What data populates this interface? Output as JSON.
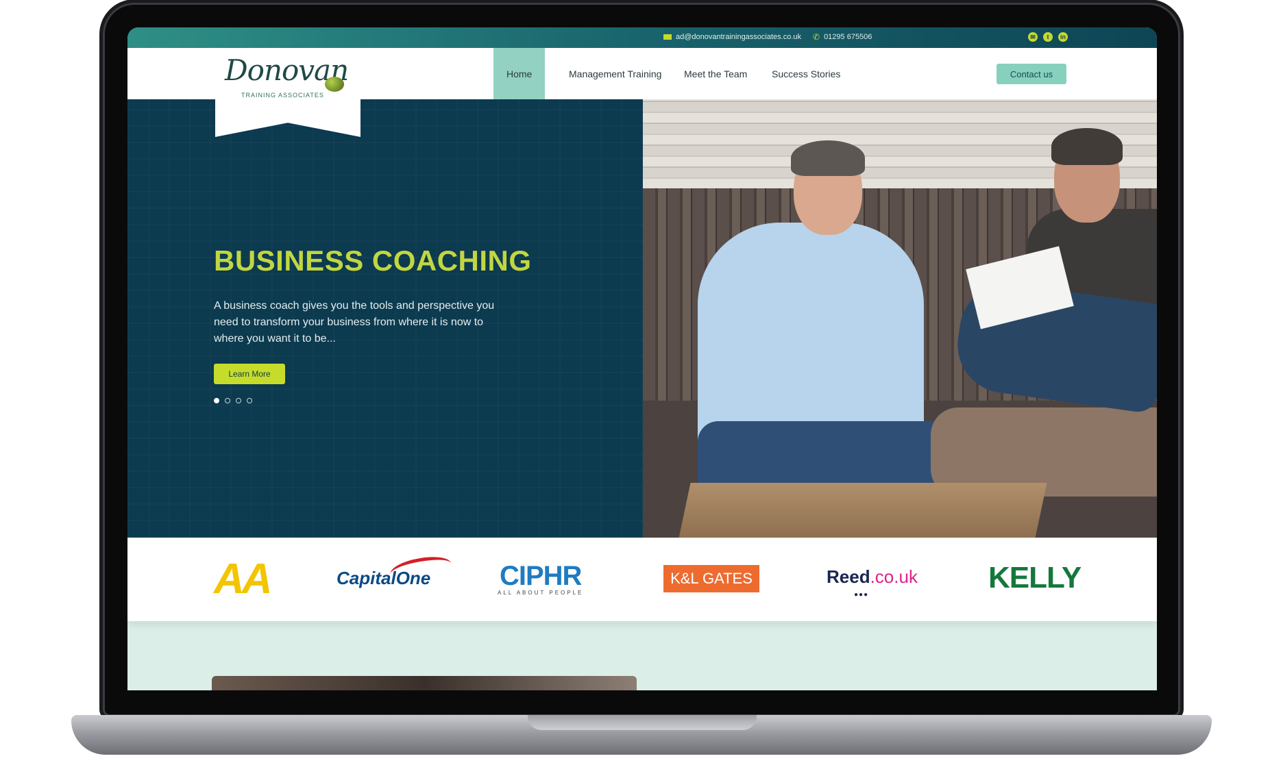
{
  "topbar": {
    "email": "ad@donovantrainingassociates.co.uk",
    "phone": "01295 675506",
    "social": [
      "email-icon",
      "twitter-icon",
      "linkedin-icon"
    ]
  },
  "logo": {
    "name": "Donovan",
    "tagline": "TRAINING ASSOCIATES"
  },
  "nav": {
    "items": [
      "Home",
      "Management Training",
      "Meet the Team",
      "Success Stories"
    ],
    "active": "Home",
    "contact": "Contact us"
  },
  "hero": {
    "title": "BUSINESS COACHING",
    "text": "A business coach gives you the tools and perspective you need to transform your business from where it is now to where you want it to be...",
    "button": "Learn More",
    "slides": 4,
    "current_slide": 1
  },
  "clients": [
    "AA",
    "CapitalOne",
    "CIPHR",
    "K&L GATES",
    "Reed.co.uk",
    "KELLY"
  ],
  "client_parts": {
    "capital": "Capital",
    "one": "One",
    "ciphr_sub": "ALL ABOUT PEOPLE",
    "reed": "Reed",
    "couk": ".co.uk",
    "reed_dots": "●●●"
  },
  "colors": {
    "hero_bg": "#0c3a4f",
    "accent_lime": "#c6dc2a",
    "nav_active": "#93d1c2"
  }
}
